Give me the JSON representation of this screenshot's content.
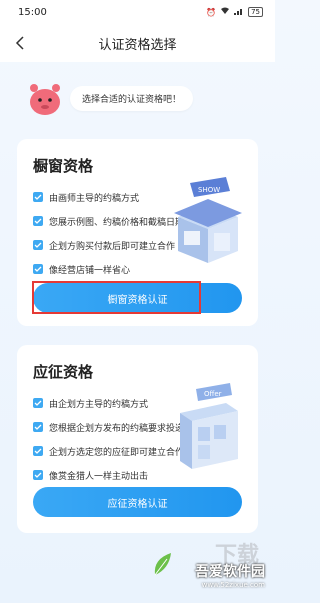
{
  "status_bar": {
    "time": "15:00",
    "battery": "75"
  },
  "header": {
    "title": "认证资格选择"
  },
  "greeting": {
    "text": "选择合适的认证资格吧！"
  },
  "window_card": {
    "title": "橱窗资格",
    "features": [
      "由画师主导的约稿方式",
      "您展示例图、约稿价格和截稿日期",
      "企划方购买付款后即可建立合作",
      "像经营店铺一样省心"
    ],
    "illustration_sign": "SHOW",
    "button": "橱窗资格认证"
  },
  "apply_card": {
    "title": "应征资格",
    "features": [
      "由企划方主导的约稿方式",
      "您根据企划方发布的约稿要求投递应征",
      "企划方选定您的应征即可建立合作",
      "像赏金猎人一样主动出击"
    ],
    "illustration_sign": "Offer",
    "button": "应征资格认证"
  },
  "watermark": {
    "big": "下载",
    "brand": "吾爱软件园",
    "url": "www.52zixue.com"
  },
  "colors": {
    "accent": "#2a9ff0",
    "highlight": "#e53935",
    "mascot": "#f06b7a"
  }
}
